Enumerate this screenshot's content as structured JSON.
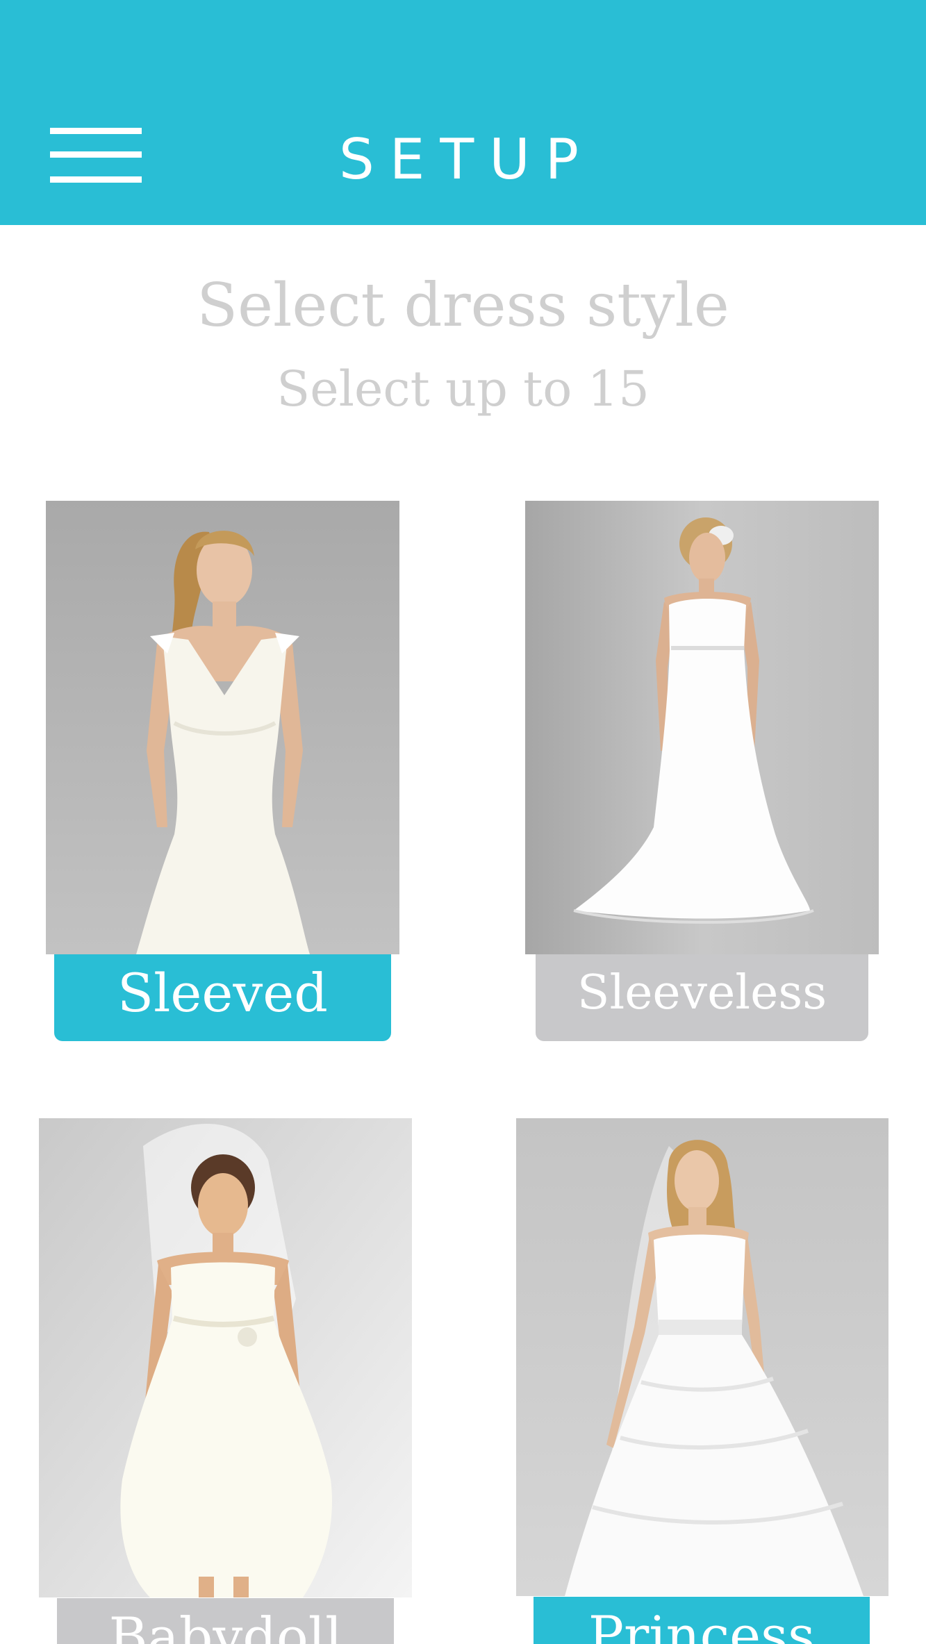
{
  "header": {
    "title": "SETUP",
    "accent_color": "#29bed5",
    "menu_icon": "hamburger-menu-icon"
  },
  "main": {
    "heading": "Select dress style",
    "subheading": "Select up to 15"
  },
  "styles": [
    {
      "label": "Sleeved",
      "selected": true
    },
    {
      "label": "Sleeveless",
      "selected": false
    },
    {
      "label": "Babydoll",
      "selected": false
    },
    {
      "label": "Princess",
      "selected": true
    }
  ]
}
